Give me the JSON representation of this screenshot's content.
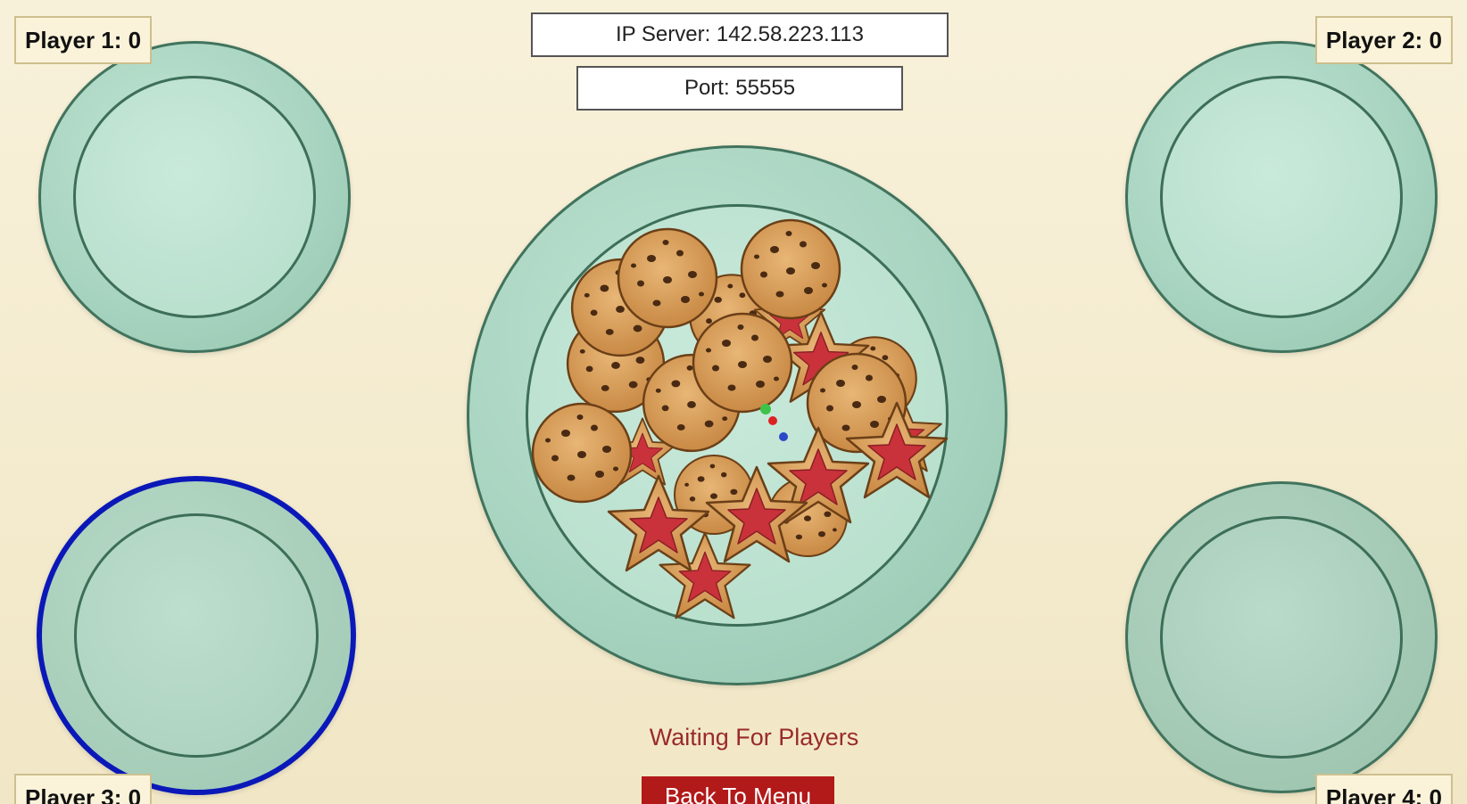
{
  "scores": {
    "player1": "Player 1: 0",
    "player2": "Player 2: 0",
    "player3": "Player 3: 0",
    "player4": "Player 4: 0"
  },
  "server": {
    "ip_label": "IP Server: 142.58.223.113",
    "port_label": "Port: 55555"
  },
  "status": "Waiting For Players",
  "back_button": "Back To Menu",
  "colors": {
    "plate": "#a6d3bf",
    "plate_outline": "#41735d",
    "selected_outline": "#0b18b8",
    "cookie": "#d9a25f",
    "jam": "#c9323a",
    "button": "#b21919",
    "status_text": "#9a2a2a"
  }
}
